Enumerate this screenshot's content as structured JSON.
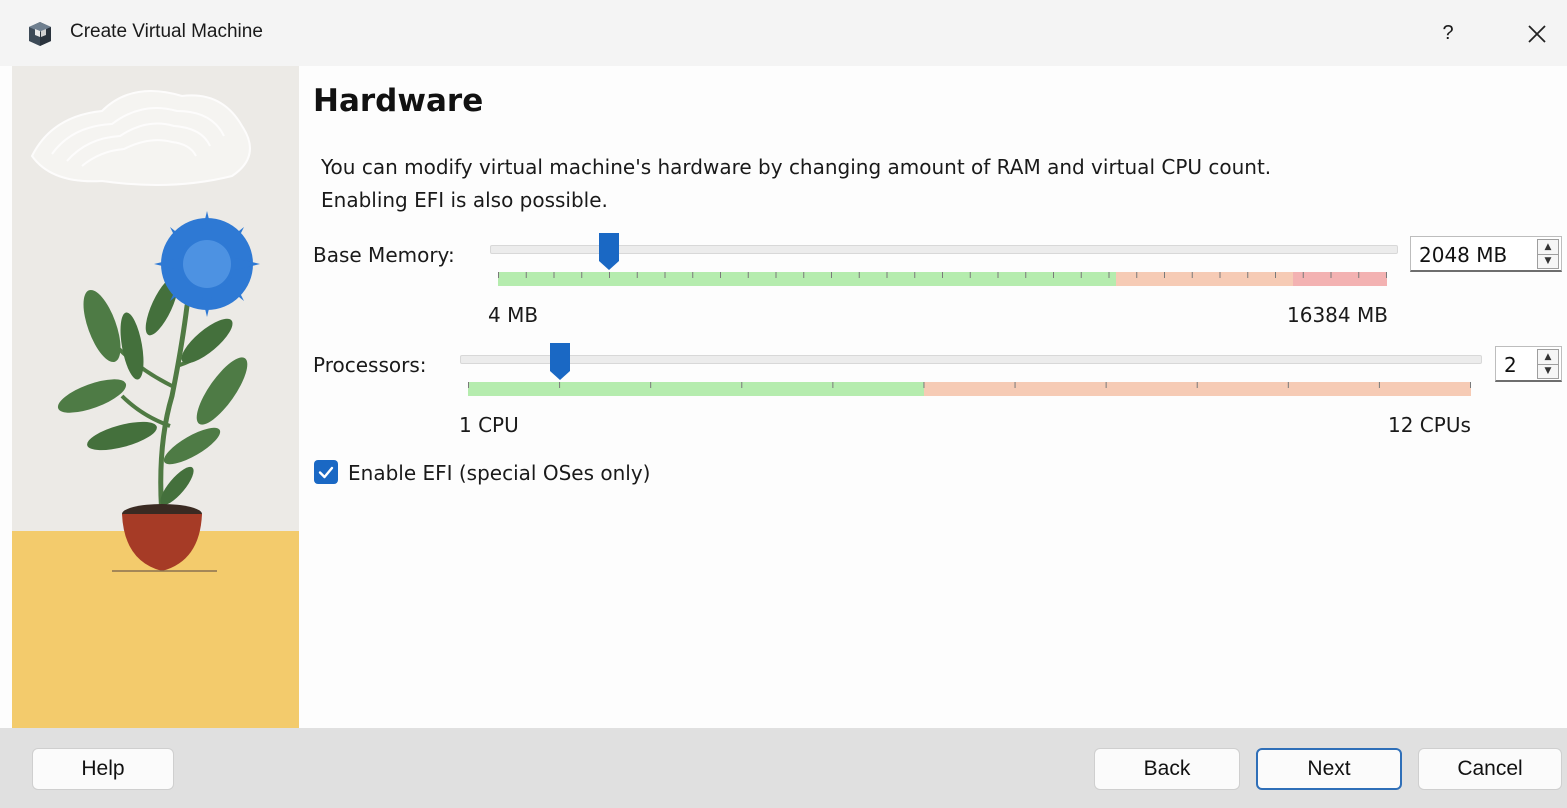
{
  "window": {
    "title": "Create Virtual Machine",
    "help_label": "?",
    "app_icon": "virtualbox-cube-icon",
    "close_icon": "close-icon"
  },
  "page": {
    "heading": "Hardware",
    "description_line1": "You can modify virtual machine's hardware by changing amount of RAM and virtual CPU count.",
    "description_line2": "Enabling EFI is also possible."
  },
  "memory": {
    "label": "Base Memory:",
    "value": "2048 MB",
    "min_label": "4 MB",
    "max_label": "16384 MB",
    "value_mb": 2048,
    "min_mb": 4,
    "max_mb": 16384
  },
  "processors": {
    "label": "Processors:",
    "value": "2",
    "min_label": "1 CPU",
    "max_label": "12 CPUs",
    "value_count": 2,
    "min_count": 1,
    "max_count": 12
  },
  "efi": {
    "label": "Enable EFI (special OSes only)",
    "checked": true
  },
  "footer": {
    "help": "Help",
    "back": "Back",
    "next": "Next",
    "cancel": "Cancel"
  },
  "colors": {
    "accent": "#1a68c4",
    "range_ok": "#b5ecae",
    "range_warn": "#f6cbb5",
    "range_danger": "#f3b2b2",
    "footer_bg": "#e0e0e0"
  }
}
